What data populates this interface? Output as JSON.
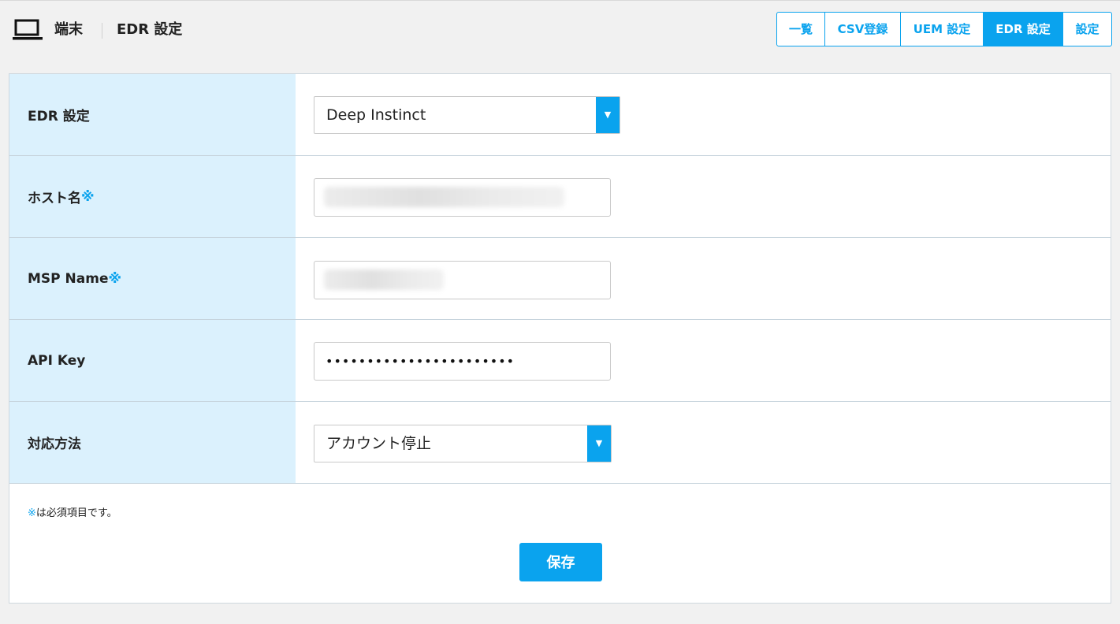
{
  "header": {
    "icon": "laptop-icon",
    "breadcrumb": {
      "section": "端末",
      "page": "EDR 設定"
    },
    "tabs": [
      {
        "label": "一覧",
        "active": false
      },
      {
        "label": "CSV登録",
        "active": false
      },
      {
        "label": "UEM 設定",
        "active": false
      },
      {
        "label": "EDR 設定",
        "active": true
      },
      {
        "label": "設定",
        "active": false
      }
    ]
  },
  "form": {
    "edr_setting": {
      "label": "EDR 設定",
      "selected": "Deep Instinct"
    },
    "host_name": {
      "label": "ホスト名",
      "required_mark": "※",
      "value": ""
    },
    "msp_name": {
      "label": "MSP Name",
      "required_mark": "※",
      "value": ""
    },
    "api_key": {
      "label": "API Key",
      "masked_value": "•••••••••••••••••••••••"
    },
    "response_method": {
      "label": "対応方法",
      "selected": "アカウント停止"
    },
    "required_note": {
      "mark": "※",
      "text": "は必須項目です。"
    },
    "save_label": "保存"
  },
  "colors": {
    "accent": "#0aa3ee",
    "label_bg": "#dbf1fd",
    "page_bg": "#f1f1f1"
  }
}
